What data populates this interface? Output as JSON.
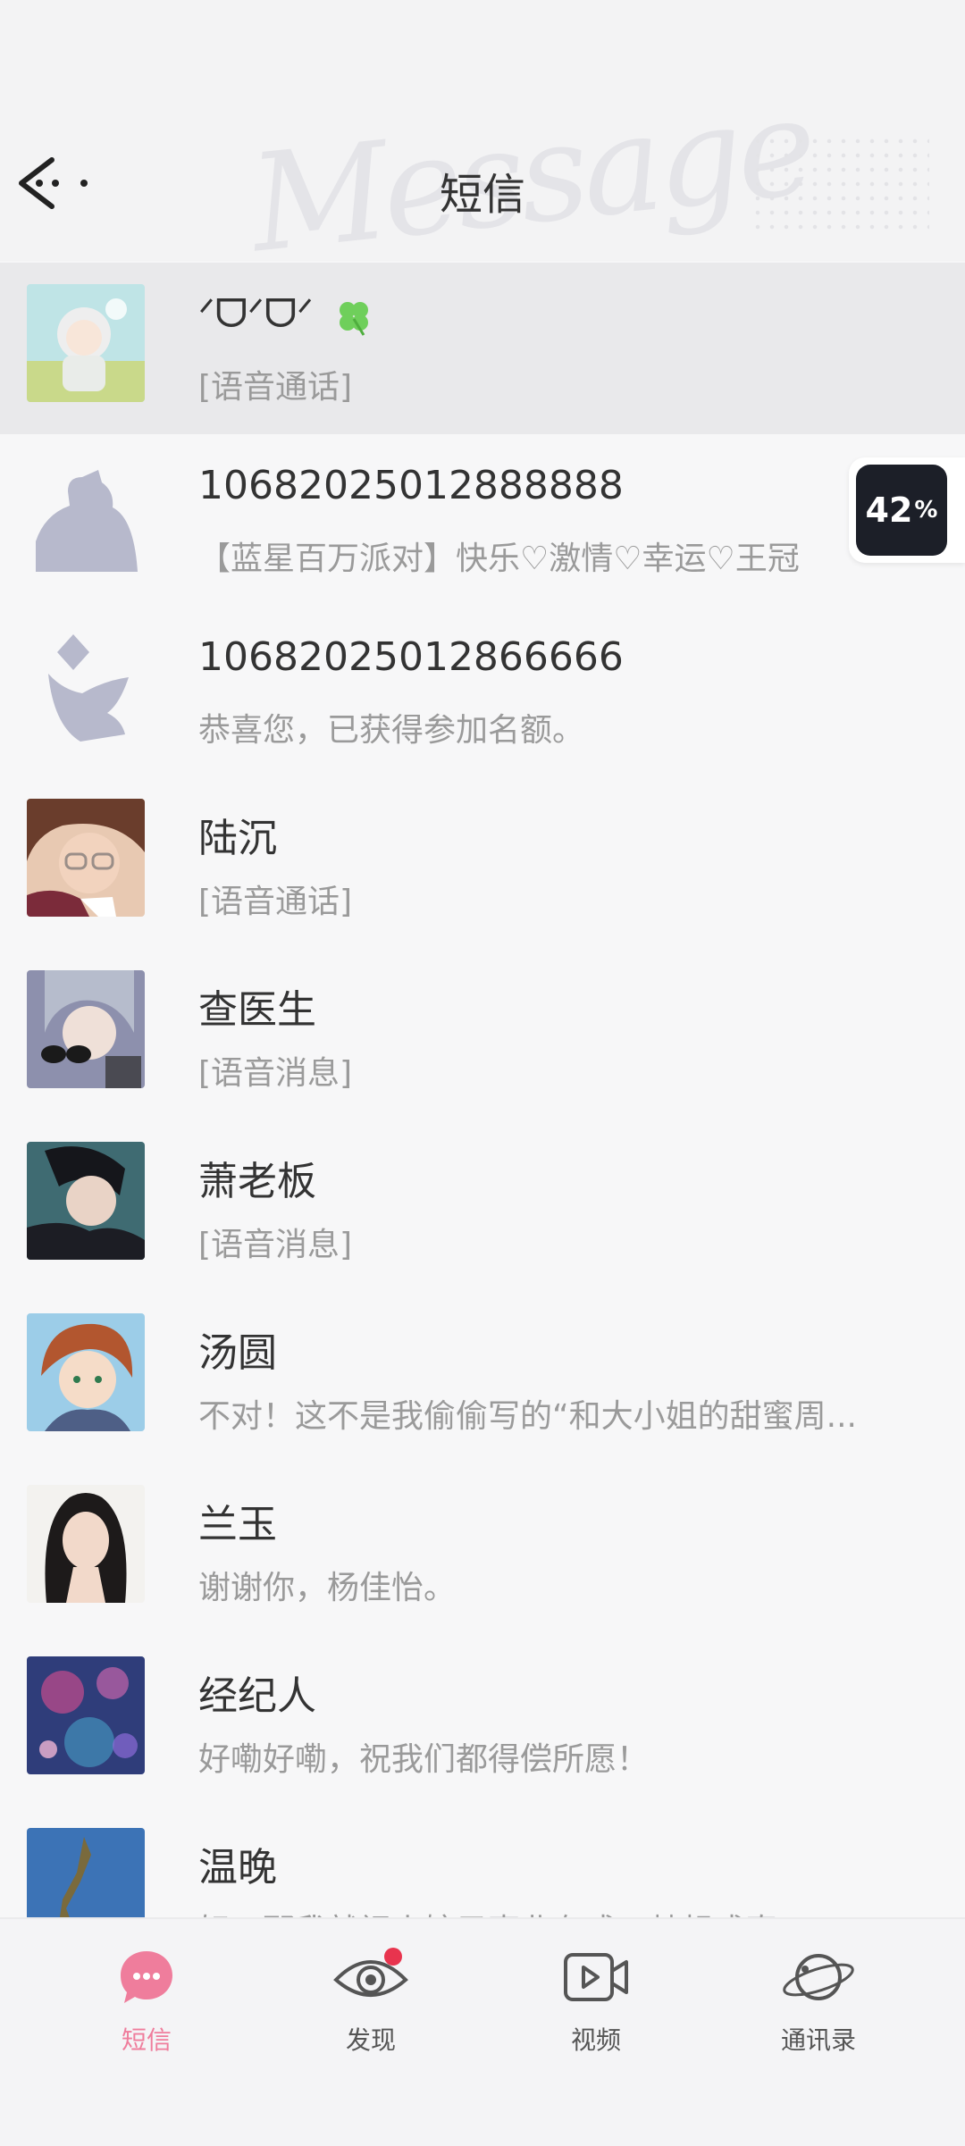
{
  "header": {
    "title": "短信",
    "watermark": "Message"
  },
  "overlay_badge": {
    "value": "42",
    "unit": "%"
  },
  "messages": [
    {
      "name": "ᐟᗜᐟᗜᐟ",
      "preview": "[语音通话]",
      "selected": true
    },
    {
      "name": "10682025012888888",
      "preview": "【蓝星百万派对】快乐♡激情♡幸运♡王冠"
    },
    {
      "name": "10682025012866666",
      "preview": "恭喜您，已获得参加名额。"
    },
    {
      "name": "陆沉",
      "preview": "[语音通话]"
    },
    {
      "name": "查医生",
      "preview": "[语音消息]"
    },
    {
      "name": "萧老板",
      "preview": "[语音消息]"
    },
    {
      "name": "汤圆",
      "preview": "不对！这不是我偷偷写的“和大小姐的甜蜜周..."
    },
    {
      "name": "兰玉",
      "preview": "谢谢你，杨佳怡。"
    },
    {
      "name": "经纪人",
      "preview": "好嘞好嘞，祝我们都得偿所愿！"
    },
    {
      "name": "温晚",
      "preview": "好！那我就祝小婶子事业有成，梦想成真！"
    }
  ],
  "tabs": [
    {
      "label": "短信",
      "icon": "message-bubble-icon",
      "active": true
    },
    {
      "label": "发现",
      "icon": "eye-icon",
      "has_dot": true
    },
    {
      "label": "视频",
      "icon": "video-icon"
    },
    {
      "label": "通讯录",
      "icon": "planet-icon"
    }
  ],
  "colors": {
    "accent": "#ef7d9c",
    "notification_dot": "#e8344e",
    "background": "#f6f6f7"
  }
}
